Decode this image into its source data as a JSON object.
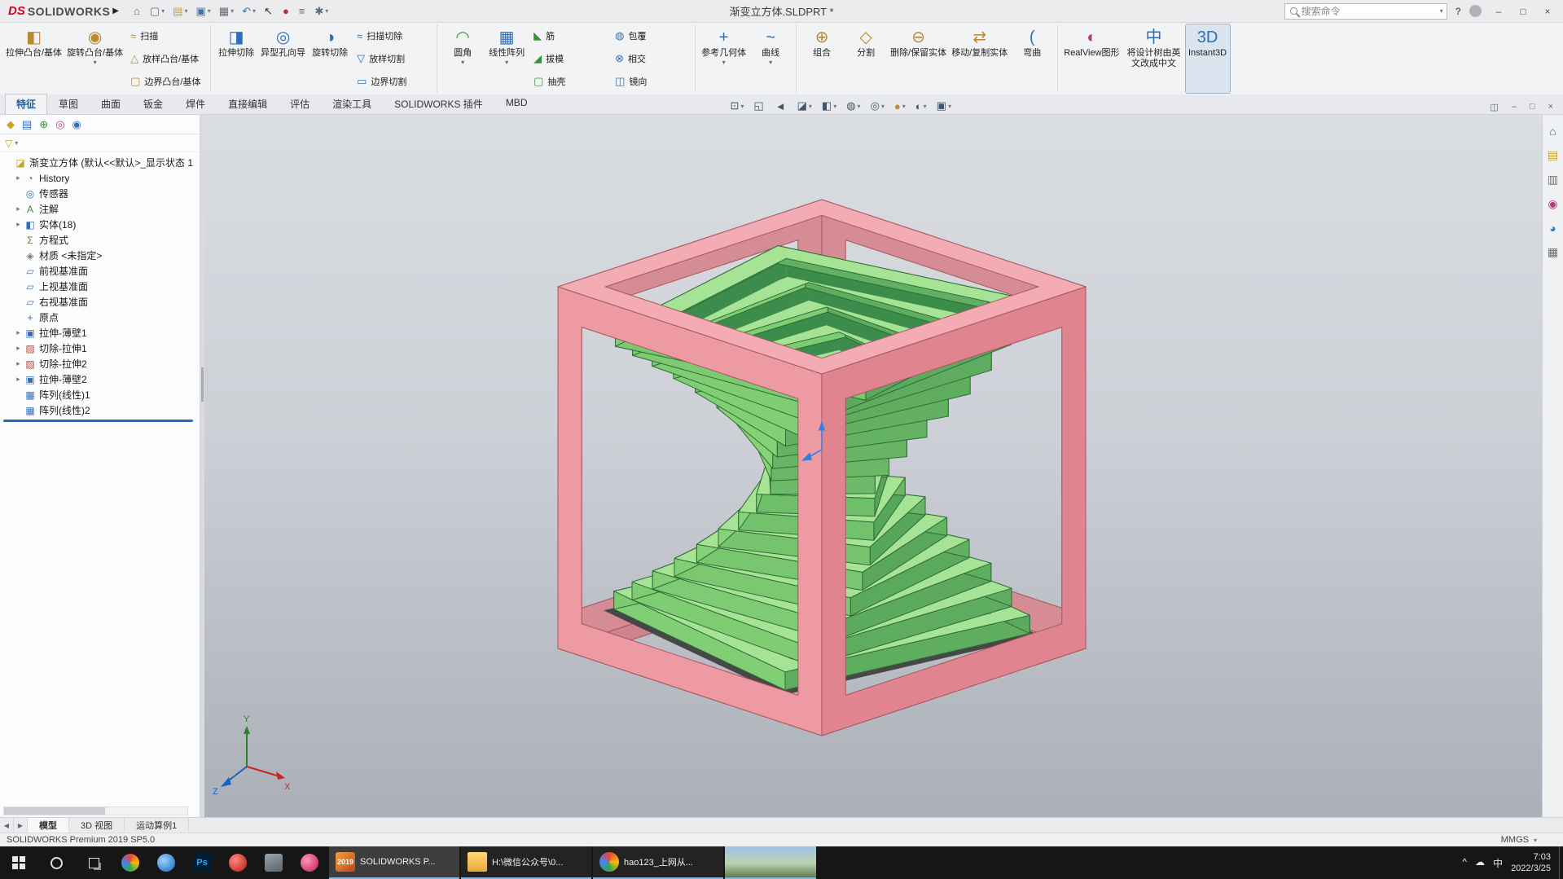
{
  "window": {
    "logo_ds": "DS",
    "logo_text": "SOLIDWORKS",
    "logo_arrow": "▶",
    "title": "渐变立方体.SLDPRT *",
    "search_placeholder": "搜索命令",
    "help": "?"
  },
  "titlebar": {
    "icons": [
      {
        "g": "⌂",
        "c": "#5a6b7a"
      },
      {
        "g": "▢",
        "c": "#5a6b7a",
        "arr": "▾"
      },
      {
        "g": "▤",
        "c": "#c9a227",
        "arr": "▾"
      },
      {
        "g": "▣",
        "c": "#3f6fae",
        "arr": "▾"
      },
      {
        "g": "▦",
        "c": "#5a6b7a",
        "arr": "▾"
      },
      {
        "g": "↶",
        "c": "#3f6fae",
        "arr": "▾"
      },
      {
        "g": "↖",
        "c": "#333333"
      },
      {
        "g": "●",
        "c": "#b23333"
      },
      {
        "g": "≡",
        "c": "#5a6b7a"
      },
      {
        "g": "✱",
        "c": "#5a6b7a",
        "arr": "▾"
      }
    ],
    "window_buttons": [
      {
        "g": "–"
      },
      {
        "g": "□"
      },
      {
        "g": "×"
      }
    ]
  },
  "ribbon_tabs": [
    {
      "label": "特征",
      "cls": "active"
    },
    {
      "label": "草图"
    },
    {
      "label": "曲面"
    },
    {
      "label": "钣金"
    },
    {
      "label": "焊件"
    },
    {
      "label": "直接编辑"
    },
    {
      "label": "评估"
    },
    {
      "label": "渲染工具"
    },
    {
      "label": "SOLIDWORKS 插件"
    },
    {
      "label": "MBD"
    }
  ],
  "ribbon": {
    "items": [
      {
        "t": "b",
        "g": "◧",
        "c": "#b98a2f",
        "label": "拉伸凸台/基体"
      },
      {
        "t": "b",
        "g": "◉",
        "c": "#b98a2f",
        "label": "旋转凸台/基体",
        "arr": "▾"
      },
      {
        "t": "s",
        "g": "≈",
        "c": "#b98a2f",
        "label": "扫描"
      },
      {
        "t": "s",
        "g": "△",
        "c": "#b98a2f",
        "label": "放样凸台/基体"
      },
      {
        "t": "s",
        "g": "▢",
        "c": "#b98a2f",
        "label": "边界凸台/基体"
      },
      {
        "t": "d"
      },
      {
        "t": "b",
        "g": "◨",
        "c": "#2f6fb9",
        "label": "拉伸切除"
      },
      {
        "t": "b",
        "g": "◎",
        "c": "#2f6fb9",
        "label": "异型孔向导"
      },
      {
        "t": "b",
        "g": "◑",
        "c": "#2f6fb9",
        "label": "旋转切除"
      },
      {
        "t": "s",
        "g": "≈",
        "c": "#2f6fb9",
        "label": "扫描切除"
      },
      {
        "t": "s",
        "g": "▽",
        "c": "#2f6fb9",
        "label": "放样切割"
      },
      {
        "t": "s",
        "g": "▭",
        "c": "#2f6fb9",
        "label": "边界切割"
      },
      {
        "t": "d"
      },
      {
        "t": "b",
        "g": "◠",
        "c": "#3a8f3a",
        "label": "圆角",
        "arr": "▾"
      },
      {
        "t": "b",
        "g": "▦",
        "c": "#2f6fb9",
        "label": "线性阵列",
        "arr": "▾"
      },
      {
        "t": "s",
        "g": "◣",
        "c": "#3a8f3a",
        "label": "筋"
      },
      {
        "t": "s",
        "g": "◢",
        "c": "#3a8f3a",
        "label": "拔模"
      },
      {
        "t": "s",
        "g": "▢",
        "c": "#3a8f3a",
        "label": "抽壳"
      },
      {
        "t": "s",
        "g": "◍",
        "c": "#2f6fb9",
        "label": "包覆"
      },
      {
        "t": "s",
        "g": "⊗",
        "c": "#2f6fb9",
        "label": "相交"
      },
      {
        "t": "s",
        "g": "◫",
        "c": "#2f6fb9",
        "label": "镜向"
      },
      {
        "t": "d"
      },
      {
        "t": "b",
        "g": "+",
        "c": "#2f6fb9",
        "label": "参考几何体",
        "arr": "▾"
      },
      {
        "t": "b",
        "g": "~",
        "c": "#2f6fb9",
        "label": "曲线",
        "arr": "▾"
      },
      {
        "t": "d"
      },
      {
        "t": "b",
        "g": "⊕",
        "c": "#b98a2f",
        "label": "组合"
      },
      {
        "t": "b",
        "g": "◇",
        "c": "#b98a2f",
        "label": "分割"
      },
      {
        "t": "b",
        "g": "⊖",
        "c": "#b98a2f",
        "label": "删除/保留实体"
      },
      {
        "t": "b",
        "g": "⇄",
        "c": "#b98a2f",
        "label": "移动/复制实体"
      },
      {
        "t": "b",
        "g": "(",
        "c": "#2f6fb9",
        "label": "弯曲"
      },
      {
        "t": "d"
      },
      {
        "t": "b",
        "g": "◐",
        "c": "#b93a7a",
        "label": "RealView图形"
      },
      {
        "t": "b",
        "g": "中",
        "c": "#2f6fb9",
        "label": "将设计树由英文改成中文"
      },
      {
        "t": "b",
        "g": "3D",
        "c": "#2f6fb9",
        "label": "Instant3D",
        "cls": "active"
      }
    ]
  },
  "headsup": [
    {
      "g": "⊡",
      "arr": "▾"
    },
    {
      "g": "◱"
    },
    {
      "g": "◄"
    },
    {
      "g": "◪",
      "arr": "▾"
    },
    {
      "g": "◧",
      "arr": "▾"
    },
    {
      "g": "◍",
      "arr": "▾"
    },
    {
      "g": "◎",
      "arr": "▾"
    },
    {
      "g": "●",
      "c": "#c9882f",
      "arr": "▾"
    },
    {
      "g": "◐",
      "arr": "▾"
    },
    {
      "g": "▣",
      "arr": "▾"
    }
  ],
  "doc_controls": [
    {
      "g": "◫"
    },
    {
      "g": "–"
    },
    {
      "g": "□"
    },
    {
      "g": "×"
    }
  ],
  "panel": {
    "tabs": [
      {
        "g": "◆",
        "c": "#c9a227"
      },
      {
        "g": "▤",
        "c": "#2f6fb9"
      },
      {
        "g": "⊕",
        "c": "#3a8f3a"
      },
      {
        "g": "◎",
        "c": "#b93a7a"
      },
      {
        "g": "◉",
        "c": "#2f6fb9"
      }
    ],
    "flyout": "›",
    "filter_glyph": "▽",
    "filter_arrow": "▾",
    "tree": [
      {
        "g": "◪",
        "c": "#c9a227",
        "a": "",
        "ind": 4,
        "label": "渐变立方体 (默认<<默认>_显示状态 1"
      },
      {
        "g": "◔",
        "c": "#8a6d3b",
        "a": "▸",
        "ind": 16,
        "label": "History"
      },
      {
        "g": "◎",
        "c": "#2f6fb9",
        "a": "",
        "ind": 16,
        "label": "传感器"
      },
      {
        "g": "A",
        "c": "#3a8f3a",
        "a": "▸",
        "ind": 16,
        "label": "注解"
      },
      {
        "g": "◧",
        "c": "#2f6fb9",
        "a": "▸",
        "ind": 16,
        "label": "实体(18)"
      },
      {
        "g": "Σ",
        "c": "#8a6d3b",
        "a": "",
        "ind": 16,
        "label": "方程式"
      },
      {
        "g": "◈",
        "c": "#7a7a7a",
        "a": "",
        "ind": 16,
        "label": "材质 <未指定>"
      },
      {
        "g": "▱",
        "c": "#4a78c0",
        "a": "",
        "ind": 16,
        "label": "前视基准面"
      },
      {
        "g": "▱",
        "c": "#4a78c0",
        "a": "",
        "ind": 16,
        "label": "上视基准面"
      },
      {
        "g": "▱",
        "c": "#4a78c0",
        "a": "",
        "ind": 16,
        "label": "右视基准面"
      },
      {
        "g": "+",
        "c": "#2f6fb9",
        "a": "",
        "ind": 16,
        "label": "原点"
      },
      {
        "g": "▣",
        "c": "#2f6fb9",
        "a": "▸",
        "ind": 16,
        "label": "拉伸-薄壁1"
      },
      {
        "g": "▨",
        "c": "#b94a3a",
        "a": "▸",
        "ind": 16,
        "label": "切除-拉伸1"
      },
      {
        "g": "▨",
        "c": "#b94a3a",
        "a": "▸",
        "ind": 16,
        "label": "切除-拉伸2"
      },
      {
        "g": "▣",
        "c": "#2f6fb9",
        "a": "▸",
        "ind": 16,
        "label": "拉伸-薄壁2"
      },
      {
        "g": "▦",
        "c": "#2f6fb9",
        "a": "",
        "ind": 16,
        "label": "阵列(线性)1"
      },
      {
        "g": "▦",
        "c": "#2f6fb9",
        "a": "",
        "ind": 16,
        "label": "阵列(线性)2"
      }
    ]
  },
  "taskpane_icons": [
    {
      "g": "⌂",
      "c": "#2f6fb9"
    },
    {
      "g": "▤",
      "c": "#c9a227"
    },
    {
      "g": "▥",
      "c": "#777777"
    },
    {
      "g": "◉",
      "c": "#b93a7a"
    },
    {
      "g": "◕",
      "c": "#2e7fb9"
    },
    {
      "g": "▦",
      "c": "#3a8f3a"
    }
  ],
  "scene": {
    "frame": {
      "top": "#f3acb3",
      "left": "#ee9aa3",
      "right": "#e0858f",
      "back": "#d68c95",
      "bottom": "#cf838d",
      "edge": "#a85560"
    },
    "rings": {
      "count": 17,
      "top": "#a6e395",
      "light": "#93e07f",
      "dark": "#3c8c4b",
      "edge": "#2e6b36"
    },
    "shadow": "#474747",
    "origin_color": "#2e7fe8",
    "triad": {
      "x": "X",
      "y": "Y",
      "z": "Z",
      "xc": "#c62828",
      "yc": "#2e7d32",
      "zc": "#1565c0"
    }
  },
  "bottom_tabs": {
    "nav": [
      {
        "g": "◀"
      },
      {
        "g": "▶"
      }
    ],
    "tabs": [
      {
        "label": "模型",
        "cls": "active"
      },
      {
        "label": "3D 视图"
      },
      {
        "label": "运动算例1"
      }
    ]
  },
  "statusbar": {
    "left": "SOLIDWORKS Premium 2019 SP5.0",
    "units": "MMGS",
    "units_arrow": "▾"
  },
  "taskbar": {
    "pinned": [
      {
        "cls": "pc-chrome"
      },
      {
        "cls": "pc-edge",
        "text": ""
      },
      {
        "cls": "pc-ps",
        "text": "Ps"
      },
      {
        "cls": "pc-red"
      },
      {
        "cls": "pc-dark"
      },
      {
        "cls": "pc-pink"
      }
    ],
    "apps": [
      {
        "icls": "ai-sw",
        "badge": "2019",
        "label": "SOLIDWORKS P...",
        "cls": "active"
      },
      {
        "icls": "ai-folder",
        "badge": "",
        "label": "H:\\微信公众号\\0..."
      },
      {
        "icls": "ai-chrome",
        "badge": "",
        "label": "hao123_上网从..."
      }
    ],
    "tray": [
      {
        "g": "^"
      },
      {
        "g": "☁"
      },
      {
        "g": "中"
      }
    ],
    "time": "7:03",
    "date": "2022/3/25"
  }
}
